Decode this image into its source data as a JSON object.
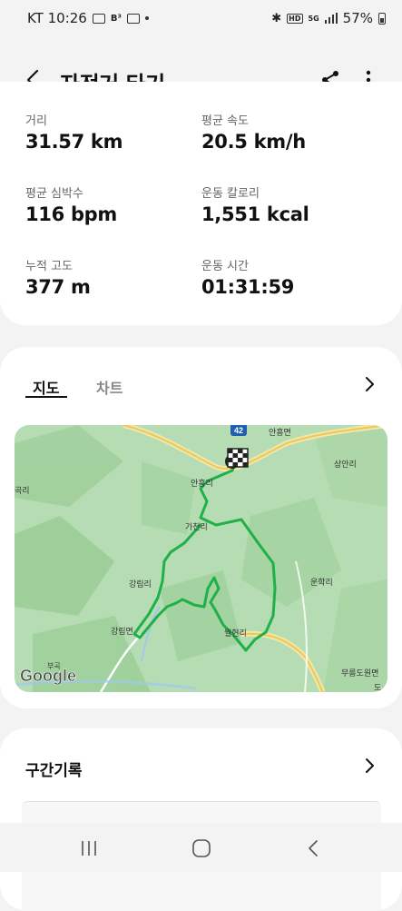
{
  "status": {
    "carrier_time": "KT 10:26",
    "b3": "B³",
    "network": "5G",
    "hd": "HD",
    "battery": "57%"
  },
  "appbar": {
    "title": "자전거 타기"
  },
  "stats": [
    {
      "label": "거리",
      "value": "31.57 km"
    },
    {
      "label": "평균 속도",
      "value": "20.5 km/h"
    },
    {
      "label": "평균 심박수",
      "value": "116 bpm"
    },
    {
      "label": "운동 칼로리",
      "value": "1,551 kcal"
    },
    {
      "label": "누적 고도",
      "value": "377 m"
    },
    {
      "label": "운동 시간",
      "value": "01:31:59"
    }
  ],
  "map_section": {
    "tabs": [
      "지도",
      "차트"
    ],
    "active_tab": "지도",
    "route_color": "#1fb04a",
    "map_bg_color": "#a9d6a8",
    "labels": {
      "route_no": "42",
      "anheung_myeon": "안흥면",
      "sangan_ri": "상안리",
      "gokri": "곡리",
      "anheung_ri": "안흥리",
      "gacheon_ri": "가천리",
      "gangnim_ri": "강림리",
      "unhak_ri": "운학리",
      "gangnim_myeon": "강림면",
      "wolhyeon_ri": "월현리",
      "mureung_do": "무릉도원면",
      "bugok": "부곡",
      "do": "도",
      "google": "Google"
    }
  },
  "section_record": {
    "title": "구간기록"
  }
}
